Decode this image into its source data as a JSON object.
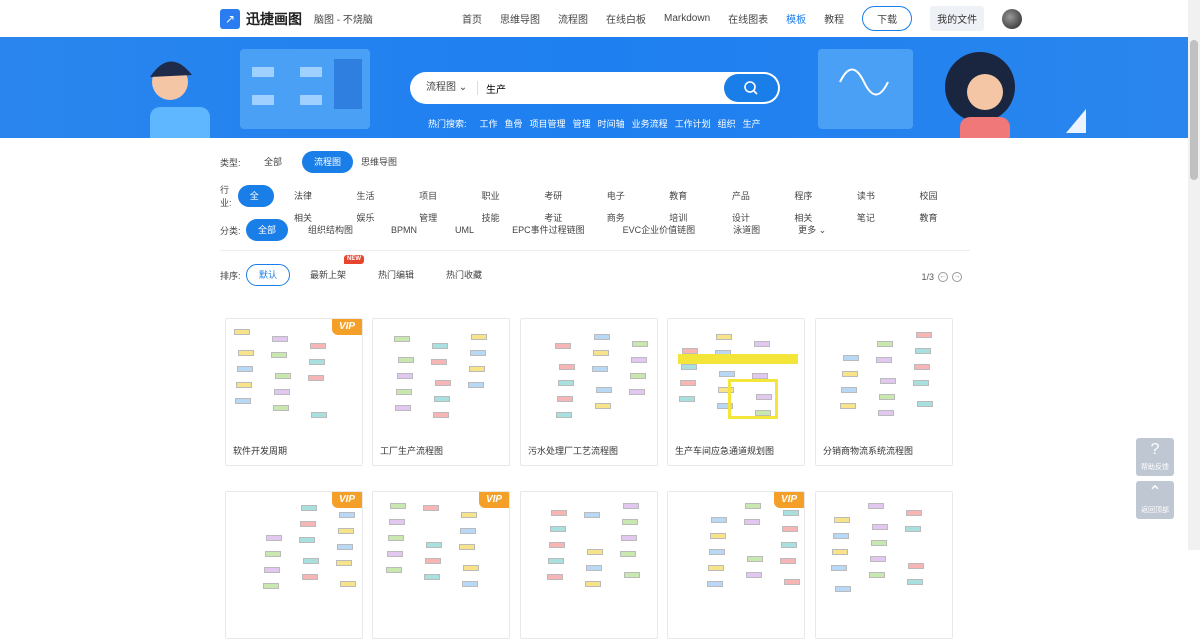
{
  "header": {
    "brand": "迅捷画图",
    "slogan": "脑图 - 不烧脑",
    "nav": [
      "首页",
      "思维导图",
      "流程图",
      "在线白板",
      "Markdown",
      "在线图表",
      "模板",
      "教程"
    ],
    "active_nav": "模板",
    "download": "下载",
    "my_files": "我的文件"
  },
  "search": {
    "type": "流程图",
    "value": "生产",
    "hot_label": "热门搜索:",
    "hot": [
      "工作",
      "鱼骨",
      "项目管理",
      "管理",
      "时间轴",
      "业务流程",
      "工作计划",
      "组织",
      "生产"
    ]
  },
  "filters": {
    "type": {
      "label": "类型:",
      "items": [
        "全部",
        "流程图",
        "思维导图"
      ],
      "selected": "流程图"
    },
    "industry": {
      "label": "行业:",
      "items": [
        "全部",
        "法律相关",
        "生活娱乐",
        "项目管理",
        "职业技能",
        "考研考证",
        "电子商务",
        "教育培训",
        "产品设计",
        "程序相关",
        "读书笔记",
        "校园教育"
      ],
      "selected": "全部"
    },
    "category": {
      "label": "分类:",
      "items": [
        "全部",
        "组织结构图",
        "BPMN",
        "UML",
        "EPC事件过程链图",
        "EVC企业价值链图",
        "泳道图"
      ],
      "more": "更多",
      "selected": "全部"
    },
    "sort": {
      "label": "排序:",
      "items": [
        "默认",
        "最新上架",
        "热门编辑",
        "热门收藏"
      ],
      "new_badge": "NEW",
      "selected": "默认"
    }
  },
  "pager": {
    "text": "1/3"
  },
  "cards": [
    {
      "title": "软件开发周期",
      "vip": true
    },
    {
      "title": "工厂生产流程图",
      "vip": false
    },
    {
      "title": "污水处理厂工艺流程图",
      "vip": false
    },
    {
      "title": "生产车间应急通道规划图",
      "vip": false
    },
    {
      "title": "分销商物流系统流程图",
      "vip": false
    },
    {
      "title": "",
      "vip": true
    },
    {
      "title": "",
      "vip": true
    },
    {
      "title": "",
      "vip": false
    },
    {
      "title": "",
      "vip": true
    },
    {
      "title": "",
      "vip": false
    }
  ],
  "vip_label": "VIP",
  "side": {
    "help": "帮助反馈",
    "top": "返回顶部"
  },
  "colors": {
    "accent": "#1a7ee8",
    "vip": "#f4a028"
  }
}
